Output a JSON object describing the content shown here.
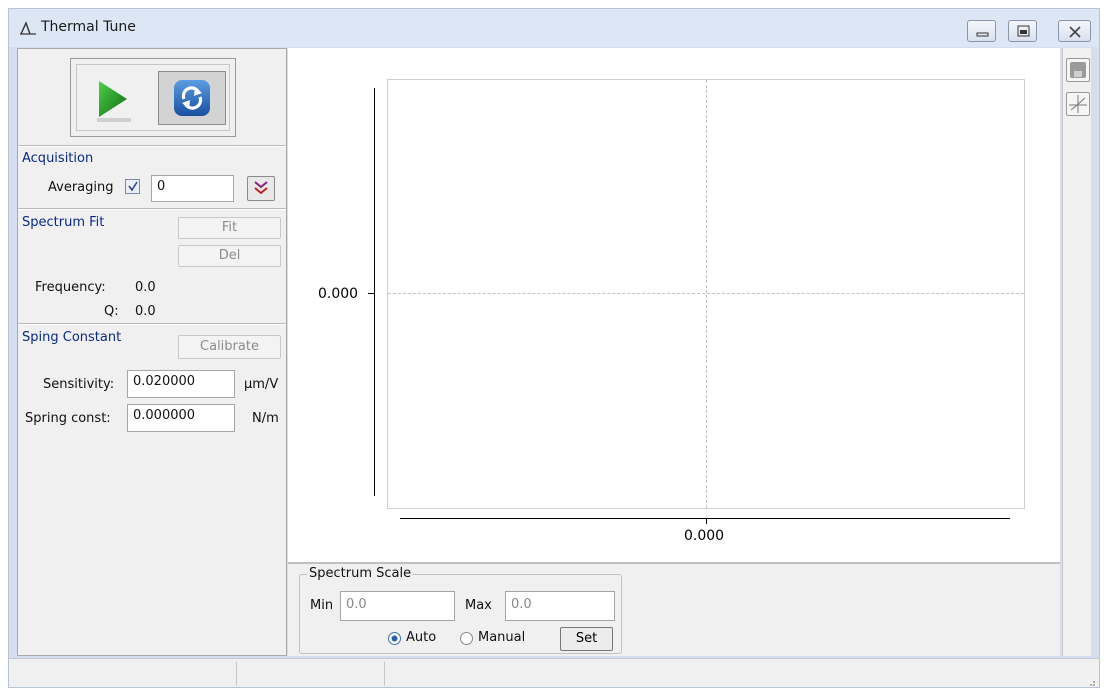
{
  "window": {
    "title": "Thermal Tune",
    "title_icon": "peak-icon",
    "controls": [
      "minimize-icon",
      "restore-icon",
      "close-icon"
    ]
  },
  "toolbar": {
    "play_icon": "play-icon",
    "refresh_icon": "refresh-icon"
  },
  "acquisition": {
    "section_label": "Acquisition",
    "averaging_label": "Averaging",
    "averaging_checked": true,
    "averaging_value": "0",
    "expand_icon": "double-chevron-down-icon"
  },
  "spectrum_fit": {
    "section_label": "Spectrum Fit",
    "fit_button": "Fit",
    "del_button": "Del",
    "frequency_label": "Frequency:",
    "frequency_value": "0.0",
    "q_label": "Q:",
    "q_value": "0.0"
  },
  "spring_constant": {
    "section_label": "Sping Constant",
    "calibrate_button": "Calibrate",
    "sensitivity_label": "Sensitivity:",
    "sensitivity_value": "0.020000",
    "sensitivity_unit": "µm/V",
    "spring_const_label": "Spring const:",
    "spring_const_value": "0.000000",
    "spring_const_unit": "N/m"
  },
  "plot": {
    "y_tick_label": "0.000",
    "x_tick_label": "0.000"
  },
  "chart_data": {
    "type": "line",
    "title": "",
    "xlabel": "",
    "ylabel": "",
    "x_ticks": [
      "0.000"
    ],
    "y_ticks": [
      "0.000"
    ],
    "series": [],
    "grid": true
  },
  "spectrum_scale": {
    "legend": "Spectrum Scale",
    "min_label": "Min",
    "min_value": "0.0",
    "max_label": "Max",
    "max_value": "0.0",
    "auto_label": "Auto",
    "manual_label": "Manual",
    "selected_mode": "Auto",
    "set_button": "Set"
  },
  "right_toolbar": {
    "icons": [
      "save-icon",
      "crosshair-icon"
    ]
  },
  "colors": {
    "section_text": "#0a2a8a",
    "frame": "#d5def0"
  }
}
